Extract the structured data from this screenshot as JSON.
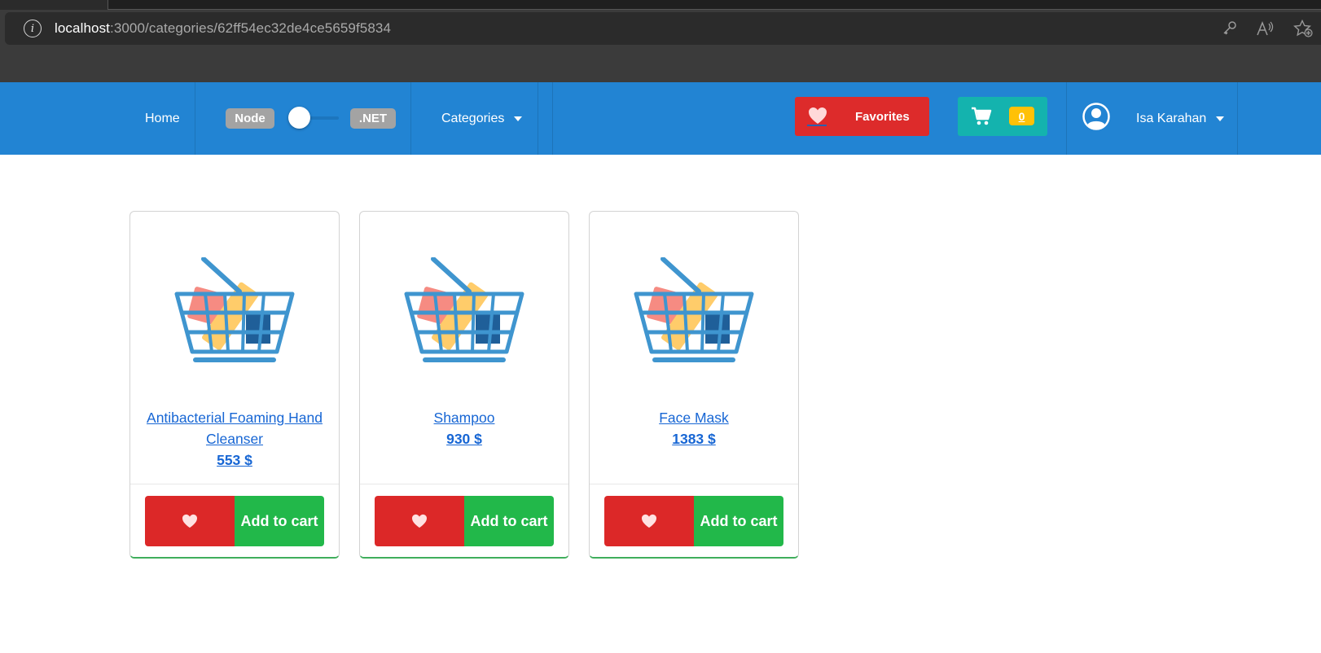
{
  "browser": {
    "url_host": "localhost",
    "url_rest": ":3000/categories/62ff54ec32de4ce5659f5834",
    "icons": [
      "info-icon",
      "key-icon",
      "read-aloud-icon",
      "add-favorite-icon"
    ]
  },
  "navbar": {
    "home_label": "Home",
    "toggle_left_label": "Node",
    "toggle_right_label": ".NET",
    "categories_label": "Categories",
    "favorites_label": "Favorites",
    "cart_count": "0",
    "user_name": "Isa Karahan",
    "colors": {
      "navbar": "#2284d3",
      "favorites": "#dd2b2b",
      "cart": "#14b3ae",
      "badge": "#ffc107"
    }
  },
  "products": [
    {
      "title": "Antibacterial Foaming Hand Cleanser",
      "price": "553 $",
      "add_to_cart_label": "Add to cart"
    },
    {
      "title": "Shampoo",
      "price": "930 $",
      "add_to_cart_label": "Add to cart"
    },
    {
      "title": "Face Mask",
      "price": "1383 $",
      "add_to_cart_label": "Add to cart"
    }
  ],
  "product_colors": {
    "favorite_button": "#dc2828",
    "cart_button": "#22b84a",
    "link": "#1766d4"
  }
}
